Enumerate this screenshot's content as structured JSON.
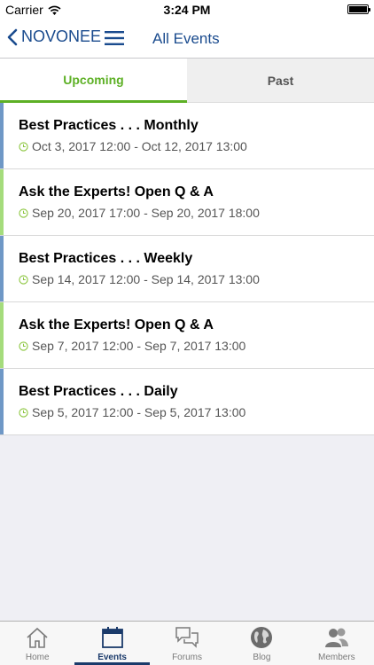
{
  "status_bar": {
    "carrier": "Carrier",
    "time": "3:24 PM"
  },
  "nav": {
    "back_label": "NOVONEE",
    "title": "All Events"
  },
  "tabs": [
    {
      "label": "Upcoming",
      "active": true
    },
    {
      "label": "Past",
      "active": false
    }
  ],
  "colors": {
    "brand_blue": "#1a4b8e",
    "accent_green": "#5db025",
    "row_blue": "#6f98c6",
    "row_green": "#a5dc7c"
  },
  "events": [
    {
      "title": "Best Practices . . . Monthly",
      "date": "Oct 3, 2017 12:00 - Oct 12, 2017 13:00",
      "accent": "#6f98c6"
    },
    {
      "title": "Ask the Experts! Open Q & A",
      "date": "Sep 20, 2017 17:00 - Sep 20, 2017 18:00",
      "accent": "#a5dc7c"
    },
    {
      "title": "Best Practices . . . Weekly",
      "date": "Sep 14, 2017 12:00 - Sep 14, 2017 13:00",
      "accent": "#6f98c6"
    },
    {
      "title": "Ask the Experts! Open Q & A",
      "date": "Sep 7, 2017 12:00 - Sep 7, 2017 13:00",
      "accent": "#a5dc7c"
    },
    {
      "title": "Best Practices . . . Daily",
      "date": "Sep 5, 2017 12:00 - Sep 5, 2017 13:00",
      "accent": "#6f98c6"
    }
  ],
  "tab_bar": [
    {
      "label": "Home",
      "icon": "home-icon"
    },
    {
      "label": "Events",
      "icon": "calendar-icon",
      "active": true
    },
    {
      "label": "Forums",
      "icon": "chat-bubbles-icon"
    },
    {
      "label": "Blog",
      "icon": "globe-icon"
    },
    {
      "label": "Members",
      "icon": "people-icon"
    }
  ]
}
